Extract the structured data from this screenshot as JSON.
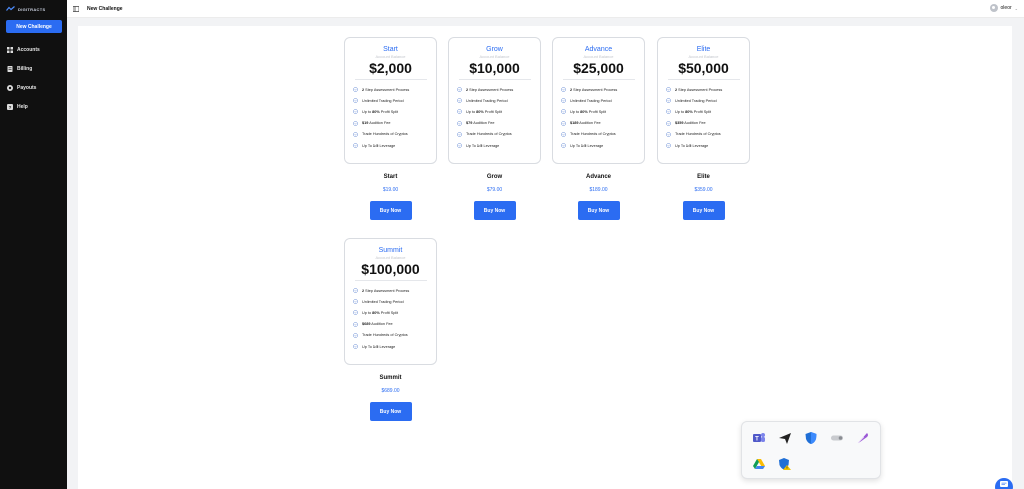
{
  "app": {
    "logo_text": "DIGITRACTS"
  },
  "sidebar": {
    "new_challenge_label": "New Challenge",
    "items": [
      {
        "label": "Accounts",
        "icon": "grid-icon"
      },
      {
        "label": "Billing",
        "icon": "billing-icon"
      },
      {
        "label": "Payouts",
        "icon": "payout-icon"
      },
      {
        "label": "Help",
        "icon": "help-icon"
      }
    ]
  },
  "header": {
    "title": "New Challenge",
    "user_name": "oleor"
  },
  "plans": [
    {
      "name": "Start",
      "subtitle": "Account Balance",
      "balance": "$2,000",
      "price": "$19.00",
      "buy_label": "Buy Now",
      "features": [
        {
          "bold": "2",
          "text": " Step Assessment Process"
        },
        {
          "bold": "",
          "text": "Unlimited Trading Period"
        },
        {
          "bold": "",
          "prefix": "Up to ",
          "mid": "80%",
          "text": " Profit Split"
        },
        {
          "bold": "$19",
          "text": " Audition Fee"
        },
        {
          "bold": "",
          "text": "Trade Hundreds of Cryptos"
        },
        {
          "bold": "",
          "prefix": "Up To ",
          "mid": "1:5",
          "text": " Leverage"
        }
      ]
    },
    {
      "name": "Grow",
      "subtitle": "Account Balance",
      "balance": "$10,000",
      "price": "$79.00",
      "buy_label": "Buy Now",
      "features": [
        {
          "bold": "2",
          "text": " Step Assessment Process"
        },
        {
          "bold": "",
          "text": "Unlimited Trading Period"
        },
        {
          "bold": "",
          "prefix": "Up to ",
          "mid": "80%",
          "text": " Profit Split"
        },
        {
          "bold": "$79",
          "text": " Audition Fee"
        },
        {
          "bold": "",
          "text": "Trade Hundreds of Cryptos"
        },
        {
          "bold": "",
          "prefix": "Up To ",
          "mid": "1:5",
          "text": " Leverage"
        }
      ]
    },
    {
      "name": "Advance",
      "subtitle": "Account Balance",
      "balance": "$25,000",
      "price": "$189.00",
      "buy_label": "Buy Now",
      "features": [
        {
          "bold": "2",
          "text": " Step Assessment Process"
        },
        {
          "bold": "",
          "text": "Unlimited Trading Period"
        },
        {
          "bold": "",
          "prefix": "Up to ",
          "mid": "80%",
          "text": " Profit Split"
        },
        {
          "bold": "$189",
          "text": " Audition Fee"
        },
        {
          "bold": "",
          "text": "Trade Hundreds of Cryptos"
        },
        {
          "bold": "",
          "prefix": "Up To ",
          "mid": "1:5",
          "text": " Leverage"
        }
      ]
    },
    {
      "name": "Elite",
      "subtitle": "Account Balance",
      "balance": "$50,000",
      "price": "$359.00",
      "buy_label": "Buy Now",
      "features": [
        {
          "bold": "2",
          "text": " Step Assessment Process"
        },
        {
          "bold": "",
          "text": "Unlimited Trading Period"
        },
        {
          "bold": "",
          "prefix": "Up to ",
          "mid": "80%",
          "text": " Profit Split"
        },
        {
          "bold": "$359",
          "text": " Audition Fee"
        },
        {
          "bold": "",
          "text": "Trade Hundreds of Cryptos"
        },
        {
          "bold": "",
          "prefix": "Up To ",
          "mid": "1:5",
          "text": " Leverage"
        }
      ]
    },
    {
      "name": "Summit",
      "subtitle": "Account Balance",
      "balance": "$100,000",
      "price": "$689.00",
      "buy_label": "Buy Now",
      "features": [
        {
          "bold": "2",
          "text": " Step Assessment Process"
        },
        {
          "bold": "",
          "text": "Unlimited Trading Period"
        },
        {
          "bold": "",
          "prefix": "Up to ",
          "mid": "80%",
          "text": " Profit Split"
        },
        {
          "bold": "$689",
          "text": " Audition Fee"
        },
        {
          "bold": "",
          "text": "Trade Hundreds of Cryptos"
        },
        {
          "bold": "",
          "prefix": "Up To ",
          "mid": "1:5",
          "text": " Leverage"
        }
      ]
    }
  ],
  "tray": {
    "icons": [
      "teams-icon",
      "send-icon",
      "shield-icon",
      "toggle-icon",
      "feather-icon",
      "drive-icon",
      "security-warning-icon"
    ]
  },
  "colors": {
    "accent": "#2b6cf2",
    "sidebar_bg": "#101010"
  }
}
